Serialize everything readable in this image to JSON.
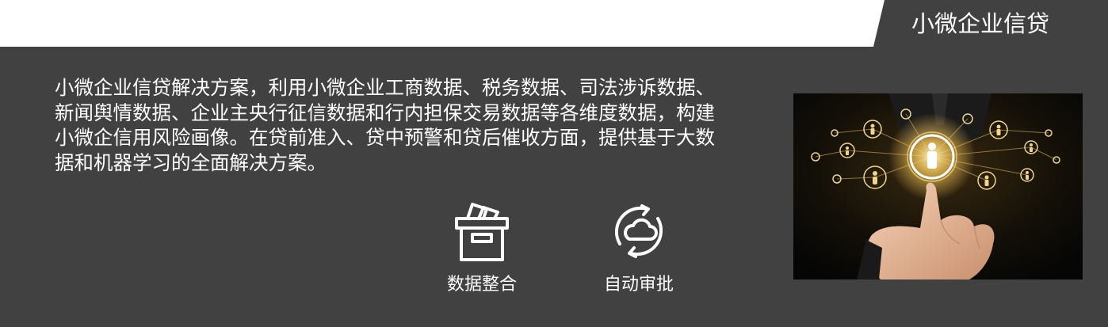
{
  "tab": {
    "title": "小微企业信贷"
  },
  "description": "小微企业信贷解决方案，利用小微企业工商数据、税务数据、司法涉诉数据、新闻舆情数据、企业主央行征信数据和行内担保交易数据等各维度数据，构建小微企信用风险画像。在贷前准入、贷中预警和贷后催收方面，提供基于大数据和机器学习的全面解决方案。",
  "features": [
    {
      "label": "数据整合",
      "icon": "box-icon"
    },
    {
      "label": "自动审批",
      "icon": "cloud-sync-icon"
    }
  ],
  "colors": {
    "panel": "#414141",
    "text": "#ffffff",
    "glow": "#f3c55a"
  }
}
